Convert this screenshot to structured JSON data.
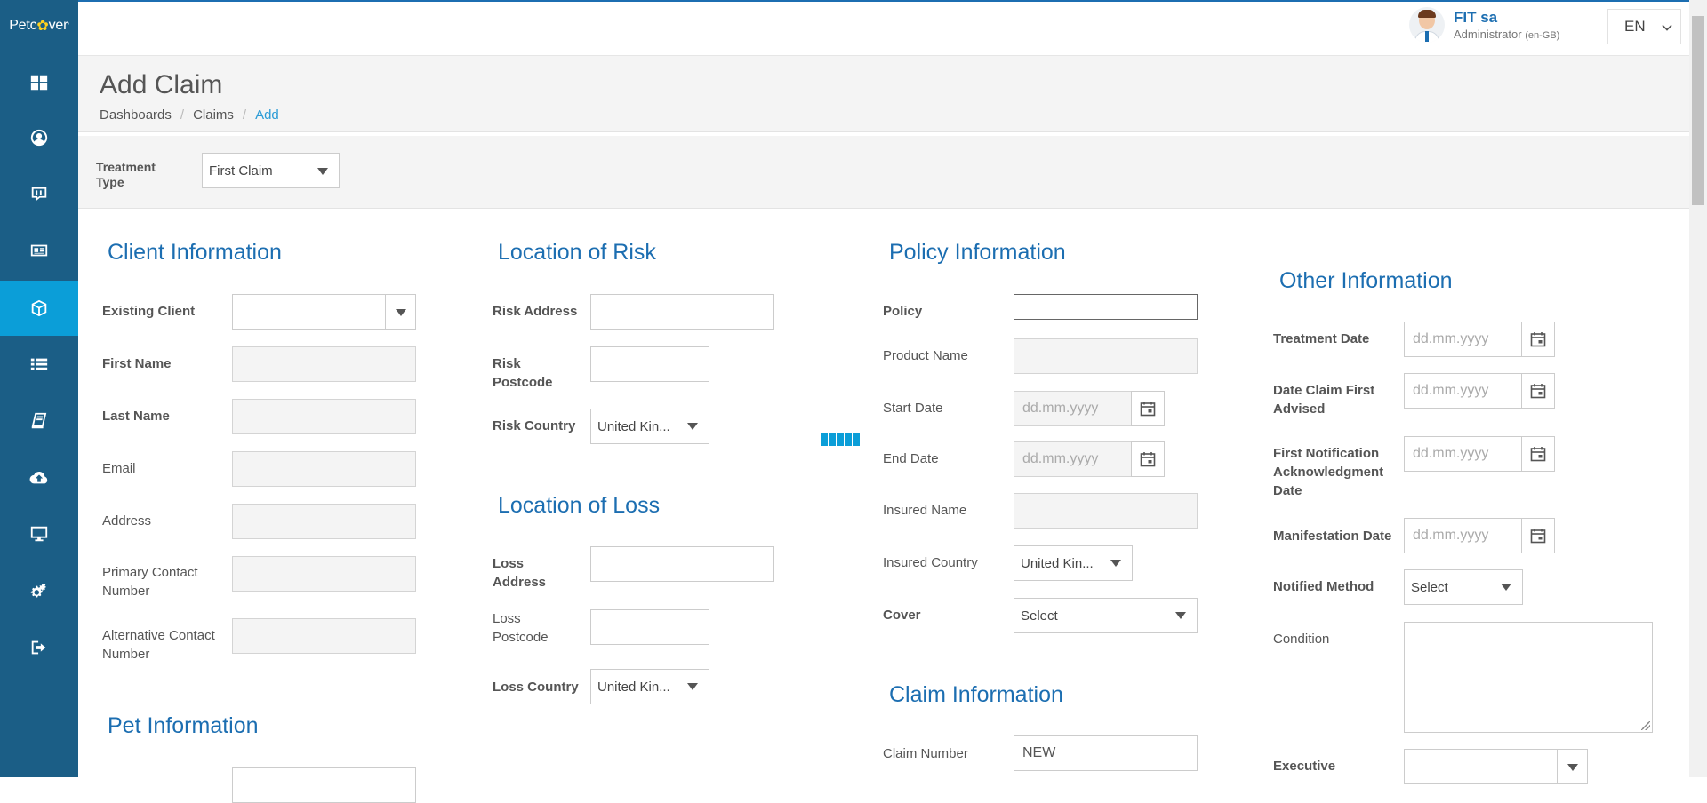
{
  "brand": {
    "name_part1": "Petc",
    "name_paw": "✿",
    "name_part2": "ver",
    "tm": "'"
  },
  "user": {
    "name": "FIT sa",
    "role": "Administrator",
    "locale": "(en-GB)"
  },
  "language": {
    "value": "EN"
  },
  "sidebar": {
    "items": [
      {
        "name": "dashboard",
        "icon": "grid-icon"
      },
      {
        "name": "clients",
        "icon": "user-circle-icon"
      },
      {
        "name": "messages",
        "icon": "chat-icon"
      },
      {
        "name": "id-card",
        "icon": "id-card-icon"
      },
      {
        "name": "claims",
        "icon": "cube-icon",
        "active": true
      },
      {
        "name": "lists",
        "icon": "list-icon"
      },
      {
        "name": "documents",
        "icon": "book-icon"
      },
      {
        "name": "upload",
        "icon": "cloud-upload-icon"
      },
      {
        "name": "screens",
        "icon": "monitor-icon"
      },
      {
        "name": "settings",
        "icon": "gears-icon"
      },
      {
        "name": "logout",
        "icon": "sign-out-icon"
      }
    ]
  },
  "page": {
    "title": "Add Claim",
    "breadcrumb": [
      "Dashboards",
      "Claims",
      "Add"
    ]
  },
  "treatment_type": {
    "label_line1": "Treatment",
    "label_line2": "Type",
    "value": "First Claim"
  },
  "client": {
    "title": "Client Information",
    "existing_client": "Existing Client",
    "first_name": "First Name",
    "last_name": "Last Name",
    "email": "Email",
    "address": "Address",
    "primary_contact_1": "Primary Contact",
    "primary_contact_2": "Number",
    "alt_contact_1": "Alternative Contact",
    "alt_contact_2": "Number"
  },
  "pet": {
    "title": "Pet Information"
  },
  "risk": {
    "title": "Location of Risk",
    "address": "Risk Address",
    "postcode_1": "Risk",
    "postcode_2": "Postcode",
    "country": "Risk Country",
    "country_value": "United Kin..."
  },
  "loss": {
    "title": "Location of Loss",
    "address_1": "Loss",
    "address_2": "Address",
    "postcode_1": "Loss",
    "postcode_2": "Postcode",
    "country": "Loss Country",
    "country_value": "United Kin..."
  },
  "policy": {
    "title": "Policy Information",
    "policy": "Policy",
    "product_name": "Product Name",
    "start_date": "Start Date",
    "end_date": "End Date",
    "insured_name": "Insured Name",
    "insured_country": "Insured Country",
    "insured_country_value": "United Kin...",
    "cover": "Cover",
    "cover_value": "Select",
    "date_placeholder": "dd.mm.yyyy"
  },
  "claim": {
    "title": "Claim Information",
    "claim_number": "Claim Number",
    "claim_number_value": "NEW"
  },
  "other": {
    "title": "Other Information",
    "treatment_date": "Treatment Date",
    "date_first_advised_1": "Date Claim First",
    "date_first_advised_2": "Advised",
    "first_notif_1": "First Notification",
    "first_notif_2": "Acknowledgment",
    "first_notif_3": "Date",
    "manifestation_date": "Manifestation Date",
    "notified_method": "Notified Method",
    "notified_method_value": "Select",
    "condition": "Condition",
    "executive": "Executive",
    "date_placeholder": "dd.mm.yyyy"
  }
}
